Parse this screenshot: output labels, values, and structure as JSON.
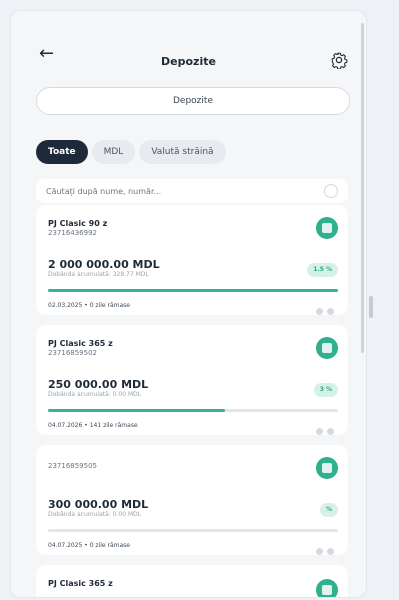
{
  "header": {
    "back_icon": "arrow-left-icon",
    "title": "Depozite",
    "settings_icon": "gear-icon"
  },
  "segment": {
    "label": "Depozite"
  },
  "filters": [
    {
      "label": "Toate",
      "active": true
    },
    {
      "label": "MDL",
      "active": false
    },
    {
      "label": "Valută străină",
      "active": false
    }
  ],
  "search": {
    "placeholder": "Căutați după nume, număr..."
  },
  "deposits": [
    {
      "name": "PJ Clasic 90 z",
      "number": "23716436992",
      "amount": "2 000 000.00 MDL",
      "interest": "Dobânda acumulată: 328.77 MDL",
      "rate": "1.5 %",
      "progress": 1.0,
      "footer": "02.03.2025 • 0 zile rămase"
    },
    {
      "name": "PJ Clasic 365 z",
      "number": "23716859502",
      "amount": "250 000.00 MDL",
      "interest": "Dobânda acumulată: 0.00 MDL",
      "rate": "3 %",
      "progress": 0.61,
      "footer": "04.07.2026 • 141 zile rămase"
    },
    {
      "name": "",
      "number": "23716859505",
      "amount": "300 000.00 MDL",
      "interest": "Dobânda acumulată: 0.00 MDL",
      "rate": "%",
      "progress": 0.0,
      "footer": "04.07.2025 • 0 zile rămase"
    },
    {
      "name": "PJ Clasic 365 z",
      "number": "",
      "amount": "",
      "interest": "",
      "rate": "",
      "progress": 0.0,
      "footer": ""
    }
  ],
  "colors": {
    "accent": "#2fb18f",
    "active_chip": "#1e2a3a",
    "progress": "#34b39a"
  }
}
